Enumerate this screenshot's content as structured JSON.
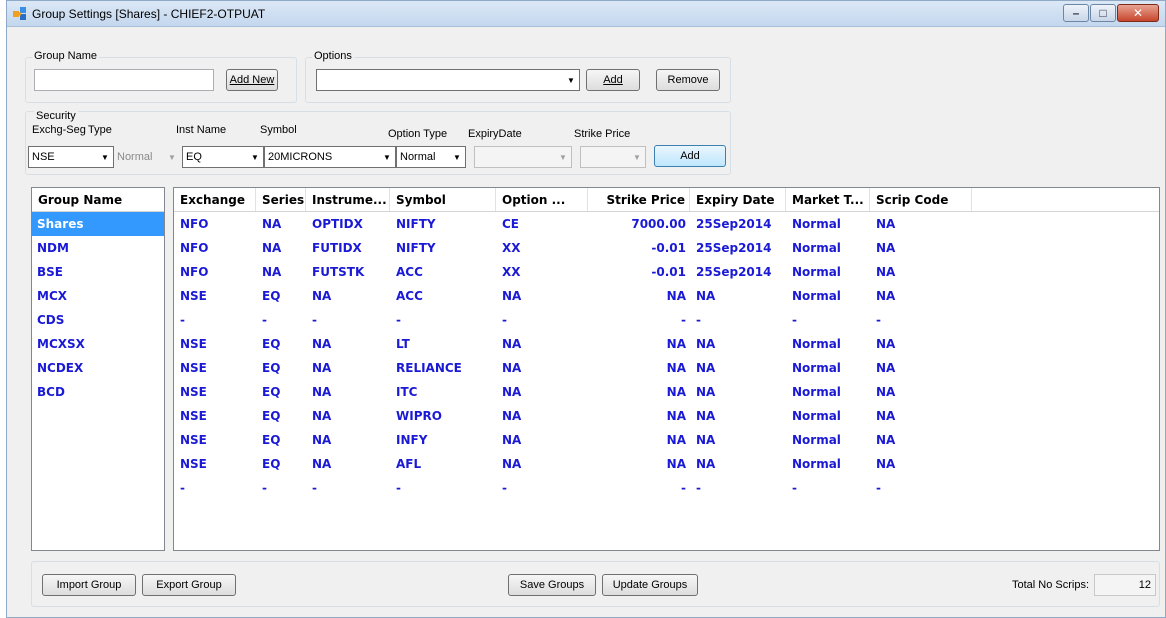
{
  "window": {
    "title": "Group Settings [Shares] - CHIEF2-OTPUAT",
    "minimize_glyph": "–",
    "maximize_glyph": "□",
    "close_glyph": "✕"
  },
  "group_name_section": {
    "legend": "Group Name",
    "input_value": "",
    "add_new_label": "Add New"
  },
  "options_section": {
    "legend": "Options",
    "selected": "",
    "add_label": "Add",
    "remove_label": "Remove"
  },
  "security_section": {
    "legend": "Security",
    "exchg_seg_label": "Exchg-Seg",
    "type_label": "Type",
    "inst_name_label": "Inst Name",
    "symbol_label": "Symbol",
    "option_type_label": "Option Type",
    "expiry_label": "ExpiryDate",
    "strike_label": "Strike Price",
    "exchg_seg_value": "NSE",
    "type_value": "Normal",
    "inst_name_value": "EQ",
    "symbol_value": "20MICRONS",
    "option_type_value": "Normal",
    "expiry_value": "",
    "strike_value": "",
    "add_label": "Add"
  },
  "group_list": {
    "header": "Group Name",
    "items": [
      "Shares",
      "NDM",
      "BSE",
      "MCX",
      "CDS",
      "MCXSX",
      "NCDEX",
      "BCD"
    ],
    "selected_index": 0
  },
  "scrip_grid": {
    "columns": [
      "Exchange",
      "Series",
      "Instrume...",
      "Symbol",
      "Option ...",
      "Strike Price",
      "Expiry Date",
      "Market T...",
      "Scrip Code"
    ],
    "rows": [
      [
        "NFO",
        "NA",
        "OPTIDX",
        "NIFTY",
        "CE",
        "7000.00",
        "25Sep2014",
        "Normal",
        "NA"
      ],
      [
        "NFO",
        "NA",
        "FUTIDX",
        "NIFTY",
        "XX",
        "-0.01",
        "25Sep2014",
        "Normal",
        "NA"
      ],
      [
        "NFO",
        "NA",
        "FUTSTK",
        "ACC",
        "XX",
        "-0.01",
        "25Sep2014",
        "Normal",
        "NA"
      ],
      [
        "NSE",
        "EQ",
        "NA",
        "ACC",
        "NA",
        "NA",
        "NA",
        "Normal",
        "NA"
      ],
      [
        "-",
        "-",
        "-",
        "-",
        "-",
        "-",
        "-",
        "-",
        "-"
      ],
      [
        "NSE",
        "EQ",
        "NA",
        "LT",
        "NA",
        "NA",
        "NA",
        "Normal",
        "NA"
      ],
      [
        "NSE",
        "EQ",
        "NA",
        "RELIANCE",
        "NA",
        "NA",
        "NA",
        "Normal",
        "NA"
      ],
      [
        "NSE",
        "EQ",
        "NA",
        "ITC",
        "NA",
        "NA",
        "NA",
        "Normal",
        "NA"
      ],
      [
        "NSE",
        "EQ",
        "NA",
        "WIPRO",
        "NA",
        "NA",
        "NA",
        "Normal",
        "NA"
      ],
      [
        "NSE",
        "EQ",
        "NA",
        "INFY",
        "NA",
        "NA",
        "NA",
        "Normal",
        "NA"
      ],
      [
        "NSE",
        "EQ",
        "NA",
        "AFL",
        "NA",
        "NA",
        "NA",
        "Normal",
        "NA"
      ],
      [
        "-",
        "-",
        "-",
        "-",
        "-",
        "-",
        "-",
        "-",
        "-"
      ]
    ]
  },
  "bottom": {
    "import_label": "Import Group",
    "export_label": "Export Group",
    "save_label": "Save Groups",
    "update_label": "Update Groups",
    "total_label": "Total No Scrips:",
    "total_value": "12"
  },
  "colors": {
    "data_text": "#1a1ad6",
    "selection": "#3399ff",
    "window_bg": "#f0f0f0"
  }
}
